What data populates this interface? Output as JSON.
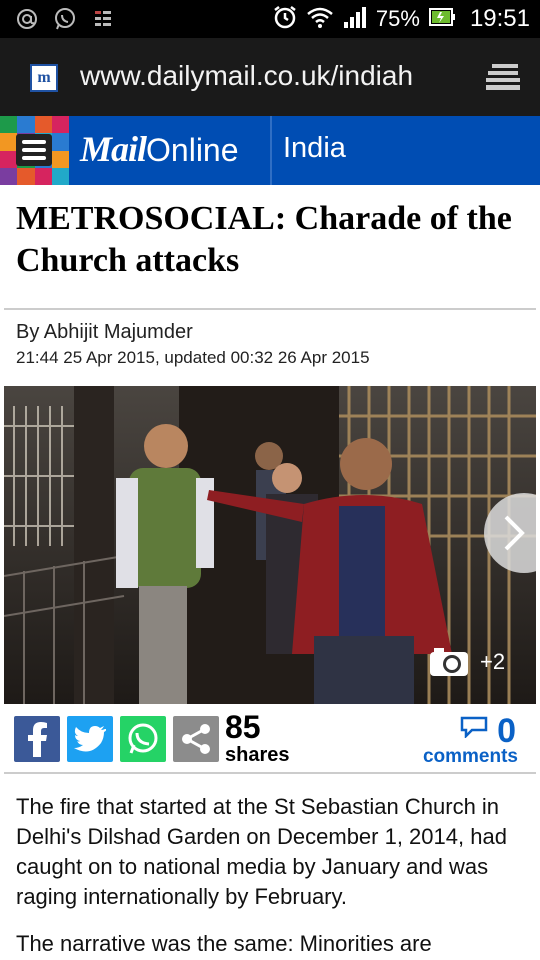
{
  "status_bar": {
    "battery": "75%",
    "time": "19:51",
    "icons": [
      "at-icon",
      "whatsapp-icon",
      "notification-icon",
      "alarm-icon",
      "wifi-icon",
      "signal-icon",
      "battery-icon"
    ]
  },
  "browser": {
    "url": "www.dailymail.co.uk/indiah",
    "favicon": "m"
  },
  "site_header": {
    "logo_mail": "Mail",
    "logo_online": "Online",
    "section": "India",
    "brand_color": "#004db3"
  },
  "article": {
    "headline": "METROSOCIAL: Charade of the Church attacks",
    "byline": "By Abhijit Majumder",
    "dateline": "21:44 25 Apr 2015, updated 00:32 26 Apr 2015",
    "photo": {
      "extra_count": "+2"
    },
    "share": {
      "count": "85",
      "label": "shares",
      "buttons": [
        "facebook",
        "twitter",
        "whatsapp",
        "share"
      ]
    },
    "comments": {
      "count": "0",
      "label": "comments"
    },
    "paragraphs": [
      "The fire that started at the St Sebastian Church in Delhi's Dilshad Garden on December 1, 2014, had caught on to national media by January and was raging internationally by February.",
      "The narrative was the same: Minorities are"
    ]
  }
}
